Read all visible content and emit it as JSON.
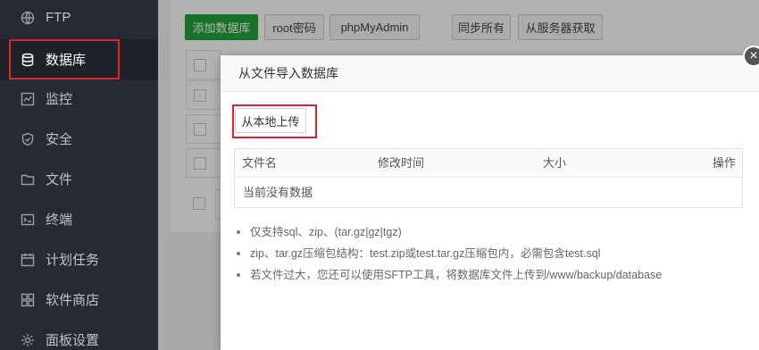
{
  "sidebar": {
    "items": [
      {
        "label": "FTP",
        "icon": "globe-icon"
      },
      {
        "label": "数据库",
        "icon": "database-icon"
      },
      {
        "label": "监控",
        "icon": "monitor-icon"
      },
      {
        "label": "安全",
        "icon": "shield-icon"
      },
      {
        "label": "文件",
        "icon": "folder-icon"
      },
      {
        "label": "终端",
        "icon": "terminal-icon"
      },
      {
        "label": "计划任务",
        "icon": "calendar-icon"
      },
      {
        "label": "软件商店",
        "icon": "apps-icon"
      },
      {
        "label": "面板设置",
        "icon": "gear-icon"
      }
    ],
    "active_index": 1
  },
  "toolbar": {
    "add_db": "添加数据库",
    "root_pw": "root密码",
    "phpmyadmin": "phpMyAdmin",
    "sync_all": "同步所有",
    "fetch_server": "从服务器获取"
  },
  "modal": {
    "title": "从文件导入数据库",
    "close": "×",
    "upload_button": "从本地上传",
    "table": {
      "columns": [
        "文件名",
        "修改时间",
        "大小",
        "操作"
      ],
      "empty_text": "当前没有数据"
    },
    "tips": [
      "仅支持sql、zip、(tar.gz|gz|tgz)",
      "zip、tar.gz压缩包结构：test.zip或test.tar.gz压缩包内，必需包含test.sql",
      "若文件过大，您还可以使用SFTP工具，将数据库文件上传到/www/backup/database"
    ]
  },
  "colors": {
    "sidebar_bg": "#262a31",
    "primary_green": "#20a53a",
    "highlight_red": "#e0242b"
  }
}
